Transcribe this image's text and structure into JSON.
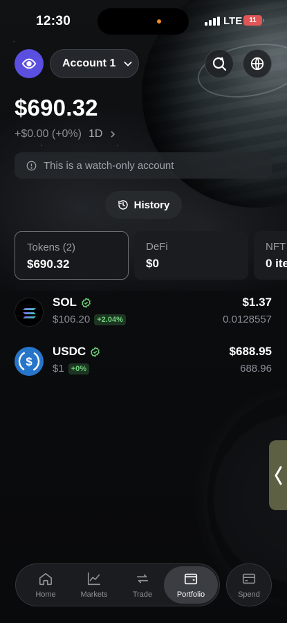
{
  "status_bar": {
    "time": "12:30",
    "network": "LTE",
    "battery": "11"
  },
  "header": {
    "account_label": "Account 1",
    "icons": {
      "watch": "eye-icon",
      "account_menu": "chevron-down-icon",
      "search": "search-icon",
      "network": "globe-icon"
    },
    "accent_color": "#5b4fe0"
  },
  "portfolio": {
    "balance": "$690.32",
    "change": "+$0.00 (+0%)",
    "period": "1D",
    "notice": "This is a watch-only account",
    "history_label": "History"
  },
  "tabs": [
    {
      "name": "Tokens (2)",
      "value": "$690.32"
    },
    {
      "name": "DeFi",
      "value": "$0"
    },
    {
      "name": "NFT",
      "value": "0 ite"
    }
  ],
  "tokens": [
    {
      "symbol": "SOL",
      "price": "$106.20",
      "change": "+2.04%",
      "value": "$1.37",
      "amount": "0.0128557"
    },
    {
      "symbol": "USDC",
      "price": "$1",
      "change": "+0%",
      "value": "$688.95",
      "amount": "688.96"
    }
  ],
  "nav": {
    "items": [
      {
        "label": "Home",
        "icon": "home-icon"
      },
      {
        "label": "Markets",
        "icon": "chart-icon"
      },
      {
        "label": "Trade",
        "icon": "swap-icon"
      },
      {
        "label": "Portfolio",
        "icon": "wallet-icon"
      }
    ],
    "spend": {
      "label": "Spend",
      "icon": "card-icon"
    }
  },
  "colors": {
    "positive": "#6fd07a",
    "side_handle": "#5d6042"
  }
}
